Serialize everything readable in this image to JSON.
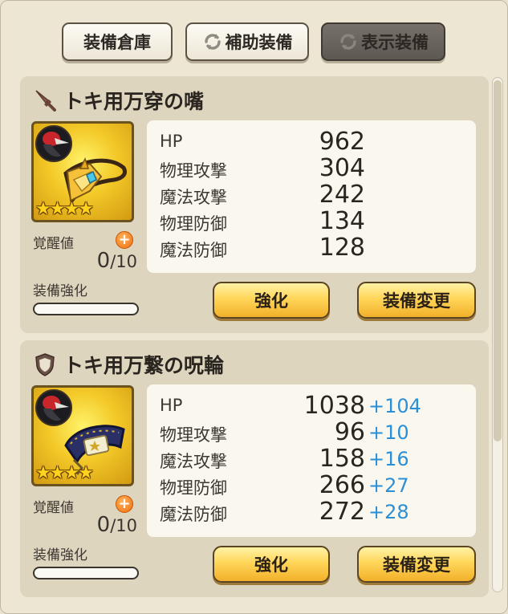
{
  "tabs": [
    {
      "label": "装備倉庫",
      "active": false,
      "icon": ""
    },
    {
      "label": "補助装備",
      "active": false,
      "icon": "refresh-icon"
    },
    {
      "label": "表示装備",
      "active": true,
      "icon": "refresh-icon"
    }
  ],
  "equipment": [
    {
      "type_icon": "weapon-dagger-icon",
      "name": "トキ用万穿の嘴",
      "stars": 4,
      "awake_label": "覚醒値",
      "awake_current": "0",
      "awake_max": "/10",
      "enhance_label": "装備強化",
      "enhance_progress": 0,
      "stats": [
        {
          "name": "HP",
          "value": "962",
          "bonus": ""
        },
        {
          "name": "物理攻撃",
          "value": "304",
          "bonus": ""
        },
        {
          "name": "魔法攻撃",
          "value": "242",
          "bonus": ""
        },
        {
          "name": "物理防御",
          "value": "134",
          "bonus": ""
        },
        {
          "name": "魔法防御",
          "value": "128",
          "bonus": ""
        }
      ],
      "enhance_button": "強化",
      "change_button": "装備変更"
    },
    {
      "type_icon": "shield-icon",
      "name": "トキ用万繋の呪輪",
      "stars": 4,
      "awake_label": "覚醒値",
      "awake_current": "0",
      "awake_max": "/10",
      "enhance_label": "装備強化",
      "enhance_progress": 0,
      "stats": [
        {
          "name": "HP",
          "value": "1038",
          "bonus": "+104"
        },
        {
          "name": "物理攻撃",
          "value": "96",
          "bonus": "+10"
        },
        {
          "name": "魔法攻撃",
          "value": "158",
          "bonus": "+16"
        },
        {
          "name": "物理防御",
          "value": "266",
          "bonus": "+27"
        },
        {
          "name": "魔法防御",
          "value": "272",
          "bonus": "+28"
        }
      ],
      "enhance_button": "強化",
      "change_button": "装備変更"
    }
  ],
  "colors": {
    "bonus": "#2b8fd6",
    "button_gold": "#ffd659",
    "plus_orange": "#f06f0e"
  }
}
